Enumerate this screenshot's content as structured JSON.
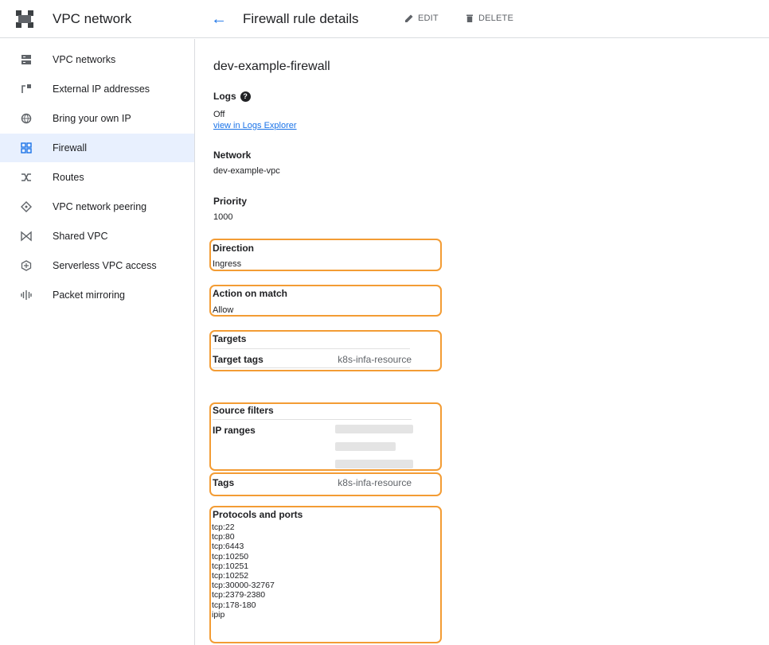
{
  "app": {
    "product_title": "VPC network"
  },
  "header": {
    "page_title": "Firewall rule details",
    "edit_label": "EDIT",
    "delete_label": "DELETE"
  },
  "sidebar": {
    "items": [
      {
        "label": "VPC networks",
        "icon": "vpc-networks-icon",
        "active": false
      },
      {
        "label": "External IP addresses",
        "icon": "external-ip-icon",
        "active": false
      },
      {
        "label": "Bring your own IP",
        "icon": "globe-icon",
        "active": false
      },
      {
        "label": "Firewall",
        "icon": "firewall-icon",
        "active": true
      },
      {
        "label": "Routes",
        "icon": "routes-icon",
        "active": false
      },
      {
        "label": "VPC network peering",
        "icon": "peering-icon",
        "active": false
      },
      {
        "label": "Shared VPC",
        "icon": "shared-vpc-icon",
        "active": false
      },
      {
        "label": "Serverless VPC access",
        "icon": "serverless-icon",
        "active": false
      },
      {
        "label": "Packet mirroring",
        "icon": "packet-mirroring-icon",
        "active": false
      }
    ]
  },
  "details": {
    "name": "dev-example-firewall",
    "logs": {
      "label": "Logs",
      "value": "Off",
      "link": "view in Logs Explorer"
    },
    "network": {
      "label": "Network",
      "value": "dev-example-vpc"
    },
    "priority": {
      "label": "Priority",
      "value": "1000"
    },
    "direction": {
      "label": "Direction",
      "value": "Ingress"
    },
    "action": {
      "label": "Action on match",
      "value": "Allow"
    },
    "targets": {
      "label": "Targets",
      "key": "Target tags",
      "value": "k8s-infa-resource"
    },
    "source_filters": {
      "label": "Source filters",
      "ip_ranges_label": "IP ranges"
    },
    "tags": {
      "label": "Tags",
      "value": "k8s-infa-resource"
    },
    "protocols": {
      "label": "Protocols and ports",
      "items": [
        "tcp:22",
        "tcp:80",
        "tcp:6443",
        "tcp:10250",
        "tcp:10251",
        "tcp:10252",
        "tcp:30000-32767",
        "tcp:2379-2380",
        "tcp:178-180",
        "ipip"
      ]
    }
  },
  "colors": {
    "accent": "#1a73e8",
    "highlight": "#f39c34",
    "active_bg": "#e8f0fe"
  }
}
